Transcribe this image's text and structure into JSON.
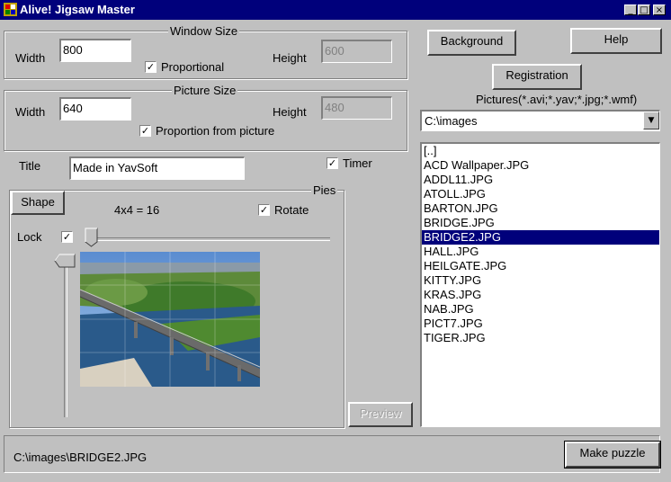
{
  "window": {
    "title": "Alive! Jigsaw Master",
    "minimize": "_",
    "maximize": "□",
    "close": "×"
  },
  "window_size": {
    "legend": "Window Size",
    "width_label": "Width",
    "width_value": "800",
    "height_label": "Height",
    "height_value": "600",
    "proportional_label": "Proportional",
    "proportional_checked": "✓"
  },
  "picture_size": {
    "legend": "Picture Size",
    "width_label": "Width",
    "width_value": "640",
    "height_label": "Height",
    "height_value": "480",
    "proportion_label": "Proportion from picture",
    "proportion_checked": "✓"
  },
  "title_field": {
    "label": "Title",
    "value": "Made in YavSoft"
  },
  "timer": {
    "label": "Timer",
    "checked": "✓"
  },
  "pies": {
    "legend": "Pies",
    "shape_button": "Shape",
    "count_text": "4x4 = 16",
    "rotate_label": "Rotate",
    "rotate_checked": "✓",
    "lock_label": "Lock",
    "lock_checked": "✓",
    "preview_button": "Preview"
  },
  "buttons": {
    "background": "Background",
    "help": "Help",
    "registration": "Registration",
    "make_puzzle": "Make puzzle"
  },
  "pictures": {
    "label": "Pictures(*.avi;*.yav;*.jpg;*.wmf)",
    "folder": "C:\\images",
    "files": [
      "[..]",
      "ACD Wallpaper.JPG",
      "ADDL11.JPG",
      "ATOLL.JPG",
      "BARTON.JPG",
      "BRIDGE.JPG",
      "BRIDGE2.JPG",
      "HALL.JPG",
      "HEILGATE.JPG",
      "KITTY.JPG",
      "KRAS.JPG",
      "NAB.JPG",
      "PICT7.JPG",
      "TIGER.JPG"
    ],
    "selected": "BRIDGE2.JPG"
  },
  "status": {
    "path": "C:\\images\\BRIDGE2.JPG"
  },
  "colors": {
    "titlebar": "#00007b",
    "face": "#c0c0c0",
    "selection": "#00007b"
  }
}
